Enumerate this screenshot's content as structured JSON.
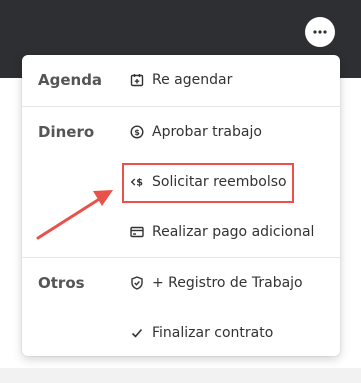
{
  "header": {
    "more_icon": "more-horizontal-icon",
    "band_color": "#2e2f32"
  },
  "menu": {
    "sections": [
      {
        "label": "Agenda",
        "items": [
          {
            "label": "Re agendar",
            "icon": "calendar-plus-icon"
          }
        ]
      },
      {
        "label": "Dinero",
        "items": [
          {
            "label": "Aprobar trabajo",
            "icon": "dollar-circle-icon"
          },
          {
            "label": "Solicitar reembolso",
            "icon": "refund-arrow-dollar-icon"
          },
          {
            "label": "Realizar pago adicional",
            "icon": "credit-card-icon"
          }
        ]
      },
      {
        "label": "Otros",
        "items": [
          {
            "label": "+ Registro de Trabajo",
            "icon": "shield-check-icon"
          },
          {
            "label": "Finalizar contrato",
            "icon": "checkmark-icon"
          }
        ]
      }
    ]
  },
  "annotation": {
    "highlight_color": "#e8524a",
    "highlighted_item": "Solicitar reembolso"
  }
}
